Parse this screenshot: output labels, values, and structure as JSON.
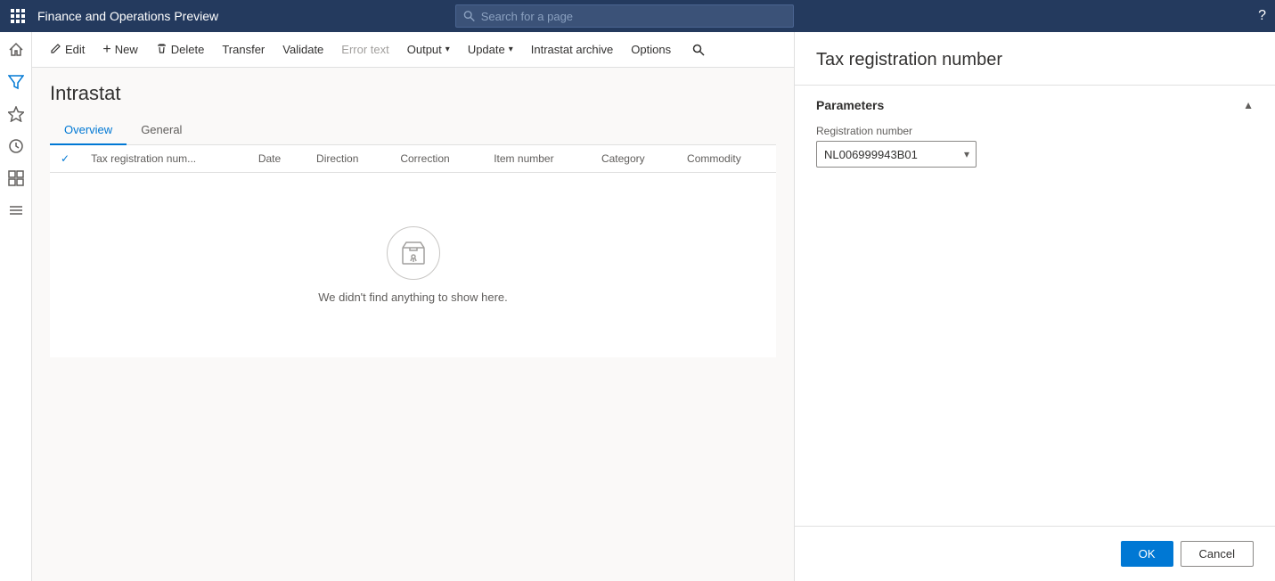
{
  "topbar": {
    "title": "Finance and Operations Preview",
    "search_placeholder": "Search for a page",
    "grid_icon": "⊞",
    "help_icon": "?"
  },
  "toolbar": {
    "edit_label": "Edit",
    "new_label": "New",
    "delete_label": "Delete",
    "transfer_label": "Transfer",
    "validate_label": "Validate",
    "error_text_label": "Error text",
    "output_label": "Output",
    "update_label": "Update",
    "intrastat_archive_label": "Intrastat archive",
    "options_label": "Options",
    "search_icon": "🔍"
  },
  "page": {
    "title": "Intrastat",
    "tabs": [
      {
        "id": "overview",
        "label": "Overview",
        "active": true
      },
      {
        "id": "general",
        "label": "General",
        "active": false
      }
    ],
    "table": {
      "columns": [
        {
          "id": "check",
          "label": ""
        },
        {
          "id": "tax_reg",
          "label": "Tax registration num..."
        },
        {
          "id": "date",
          "label": "Date"
        },
        {
          "id": "direction",
          "label": "Direction"
        },
        {
          "id": "correction",
          "label": "Correction"
        },
        {
          "id": "item_number",
          "label": "Item number"
        },
        {
          "id": "category",
          "label": "Category"
        },
        {
          "id": "commodity",
          "label": "Commodity"
        }
      ],
      "empty_message": "We didn't find anything to show here."
    }
  },
  "right_panel": {
    "title": "Tax registration number",
    "section_label": "Parameters",
    "registration_number_label": "Registration number",
    "registration_number_value": "NL006999943B01",
    "registration_options": [
      "NL006999943B01"
    ],
    "ok_label": "OK",
    "cancel_label": "Cancel"
  },
  "sidebar": {
    "items": [
      {
        "id": "home",
        "icon": "⌂",
        "label": "Home"
      },
      {
        "id": "filter",
        "icon": "⚗",
        "label": "Filter"
      },
      {
        "id": "favorites",
        "icon": "☆",
        "label": "Favorites"
      },
      {
        "id": "recent",
        "icon": "⏱",
        "label": "Recent"
      },
      {
        "id": "workspaces",
        "icon": "▦",
        "label": "Workspaces"
      },
      {
        "id": "modules",
        "icon": "≡",
        "label": "Modules"
      }
    ]
  }
}
